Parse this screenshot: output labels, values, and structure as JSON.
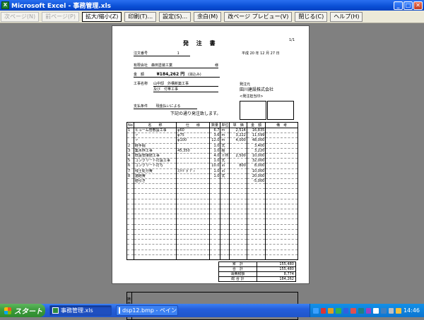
{
  "window": {
    "title": "Microsoft Excel - 事務管理.xls",
    "controls": [
      "_",
      "□",
      "✕"
    ]
  },
  "toolbar": {
    "buttons": [
      {
        "label": "次ページ(N)",
        "state": "disabled"
      },
      {
        "label": "前ページ(P)",
        "state": "disabled"
      },
      {
        "label": "拡大/縮小(Z)",
        "state": "pressed"
      },
      {
        "label": "印刷(T)...",
        "state": "normal"
      },
      {
        "label": "設定(S)...",
        "state": "normal"
      },
      {
        "label": "余白(M)",
        "state": "normal"
      },
      {
        "label": "改ページ プレビュー(V)",
        "state": "normal"
      },
      {
        "label": "閉じる(C)",
        "state": "normal"
      },
      {
        "label": "ヘルプ(H)",
        "state": "normal"
      }
    ]
  },
  "doc": {
    "page_no": "1/1",
    "title": "発 注 書",
    "order_no_label": "注文番号",
    "order_no_value": "1",
    "date_text": "平成 20 年 12 月 27 日",
    "recipient": "有限会社　森田塗装工業",
    "honorific": "様",
    "amount_label": "金　額",
    "amount_value": "¥184,262 円",
    "amount_tax": "(消込み)",
    "project_label": "工事名称",
    "project_line1": "山中邸　外構新築工事",
    "project_line2": "及び　付帯工事",
    "issuer_label": "発注元",
    "issuer_name": "田川建設株式会社",
    "stamp_label": "<発注担当印>",
    "payment_label": "支払条件",
    "payment_value": "現金払いによる",
    "notice": "下記の通り発注致します。",
    "table_headers": [
      "No",
      "名　　称",
      "仕　　様",
      "数量",
      "単位",
      "単　価",
      "金　額",
      "備　考"
    ],
    "items": [
      {
        "no": "1",
        "name": "ヒューム管敷設工事",
        "spec": "φ60",
        "qty": "6.7",
        "unit": "m",
        "price": "2,514",
        "amount": "16,835",
        "note": ""
      },
      {
        "no": "",
        "name": "〃",
        "spec": "φ75",
        "qty": "3.6",
        "unit": "m",
        "price": "3,222",
        "amount": "11,599",
        "note": ""
      },
      {
        "no": "",
        "name": "〃",
        "spec": "φ100",
        "qty": "12.0",
        "unit": "m",
        "price": "4,000",
        "amount": "48,000",
        "note": ""
      },
      {
        "no": "2",
        "name": "経手掘",
        "spec": "",
        "qty": "1.0",
        "unit": "式",
        "price": "",
        "amount": "3,400",
        "note": ""
      },
      {
        "no": "3",
        "name": "集水桝工事",
        "spec": "45,350",
        "qty": "1.0",
        "unit": "組",
        "price": "",
        "amount": "3,220",
        "note": ""
      },
      {
        "no": "4",
        "name": "既設管接続工事",
        "spec": "",
        "qty": "4.0",
        "unit": "ヶ所",
        "price": "2,500",
        "amount": "10,000",
        "note": ""
      },
      {
        "no": "5",
        "name": "コンクリート打設工事",
        "spec": "",
        "qty": "1.0",
        "unit": "式",
        "price": "",
        "amount": "32,000",
        "note": ""
      },
      {
        "no": "6",
        "name": "コンクリート打ち",
        "spec": "",
        "qty": "10.0",
        "unit": "㎡",
        "price": "800",
        "amount": "8,000",
        "note": ""
      },
      {
        "no": "7",
        "name": "残土処分費",
        "spec": "ｽﾗｲﾄﾞﾎﾞﾃﾞｨ",
        "qty": "1.0",
        "unit": "㎡",
        "price": "",
        "amount": "10,000",
        "note": ""
      },
      {
        "no": "8",
        "name": "諸経費",
        "spec": "",
        "qty": "1.0",
        "unit": "式",
        "price": "",
        "amount": "20,000",
        "note": ""
      },
      {
        "no": "",
        "name": "値引き",
        "spec": "",
        "qty": "",
        "unit": "",
        "price": "",
        "amount": "-5,000",
        "note": ""
      },
      {
        "no": "",
        "name": "",
        "spec": "",
        "qty": "",
        "unit": "",
        "price": "",
        "amount": "",
        "note": ""
      },
      {
        "no": "",
        "name": "",
        "spec": "",
        "qty": "",
        "unit": "",
        "price": "",
        "amount": "",
        "note": ""
      },
      {
        "no": "",
        "name": "",
        "spec": "",
        "qty": "",
        "unit": "",
        "price": "",
        "amount": "",
        "note": ""
      },
      {
        "no": "",
        "name": "",
        "spec": "",
        "qty": "",
        "unit": "",
        "price": "",
        "amount": "",
        "note": ""
      },
      {
        "no": "",
        "name": "",
        "spec": "",
        "qty": "",
        "unit": "",
        "price": "",
        "amount": "",
        "note": ""
      },
      {
        "no": "",
        "name": "",
        "spec": "",
        "qty": "",
        "unit": "",
        "price": "",
        "amount": "",
        "note": ""
      },
      {
        "no": "",
        "name": "",
        "spec": "",
        "qty": "",
        "unit": "",
        "price": "",
        "amount": "",
        "note": ""
      },
      {
        "no": "",
        "name": "",
        "spec": "",
        "qty": "",
        "unit": "",
        "price": "",
        "amount": "",
        "note": ""
      },
      {
        "no": "",
        "name": "",
        "spec": "",
        "qty": "",
        "unit": "",
        "price": "",
        "amount": "",
        "note": ""
      },
      {
        "no": "",
        "name": "",
        "spec": "",
        "qty": "",
        "unit": "",
        "price": "",
        "amount": "",
        "note": ""
      },
      {
        "no": "",
        "name": "",
        "spec": "",
        "qty": "",
        "unit": "",
        "price": "",
        "amount": "",
        "note": ""
      },
      {
        "no": "",
        "name": "",
        "spec": "",
        "qty": "",
        "unit": "",
        "price": "",
        "amount": "",
        "note": ""
      },
      {
        "no": "",
        "name": "",
        "spec": "",
        "qty": "",
        "unit": "",
        "price": "",
        "amount": "",
        "note": ""
      },
      {
        "no": "",
        "name": "",
        "spec": "",
        "qty": "",
        "unit": "",
        "price": "",
        "amount": "",
        "note": ""
      },
      {
        "no": "",
        "name": "",
        "spec": "",
        "qty": "",
        "unit": "",
        "price": "",
        "amount": "",
        "note": ""
      }
    ],
    "totals": [
      {
        "label": "累　計",
        "value": "155,480"
      },
      {
        "label": "合　計",
        "value": "155,480"
      },
      {
        "label": "消費税額",
        "value": "8,774"
      },
      {
        "label": "総 合 計",
        "value": "184,262"
      }
    ],
    "remarks_label": "摘\n要"
  },
  "taskbar": {
    "start_label": "スタート",
    "tasks": [
      {
        "label": "事務管理.xls",
        "active": true,
        "icon": "excel-icon"
      },
      {
        "label": "dsp12.bmp - ペイント",
        "active": false,
        "icon": "paint-icon"
      }
    ],
    "tray_icon_colors": [
      "#3aa0ff",
      "#d33",
      "#e0a020",
      "#36b34a",
      "#3060e0",
      "#e05050",
      "#208080",
      "#a040c0",
      "#ffffff",
      "#4080c0",
      "#c0c0c0",
      "#f0c040"
    ],
    "clock": "14:46"
  }
}
